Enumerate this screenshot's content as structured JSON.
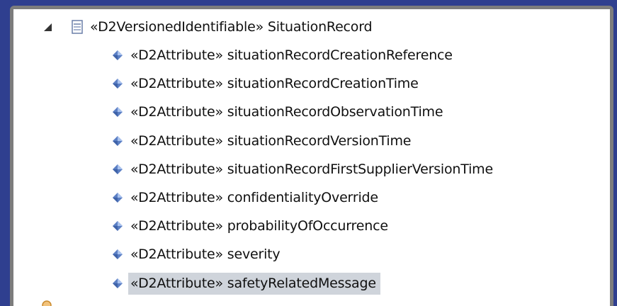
{
  "tree": {
    "root": {
      "label": "«D2VersionedIdentifiable» SituationRecord",
      "expander_icon": "collapse-triangle-icon",
      "icon": "class-icon"
    },
    "attributes": [
      {
        "label": "«D2Attribute» situationRecordCreationReference",
        "selected": false
      },
      {
        "label": "«D2Attribute» situationRecordCreationTime",
        "selected": false
      },
      {
        "label": "«D2Attribute» situationRecordObservationTime",
        "selected": false
      },
      {
        "label": "«D2Attribute» situationRecordVersionTime",
        "selected": false
      },
      {
        "label": "«D2Attribute» situationRecordFirstSupplierVersionTime",
        "selected": false
      },
      {
        "label": "«D2Attribute» confidentialityOverride",
        "selected": false
      },
      {
        "label": "«D2Attribute» probabilityOfOccurrence",
        "selected": false
      },
      {
        "label": "«D2Attribute» severity",
        "selected": false
      },
      {
        "label": "«D2Attribute» safetyRelatedMessage",
        "selected": true
      }
    ],
    "attribute_icon": "attribute-diamond-icon"
  },
  "colors": {
    "background": "#2f3f8f",
    "frame": "#7d7d7d",
    "panel": "#ffffff",
    "selection": "#cfd4db",
    "attribute_icon": "#5b7fc4"
  }
}
